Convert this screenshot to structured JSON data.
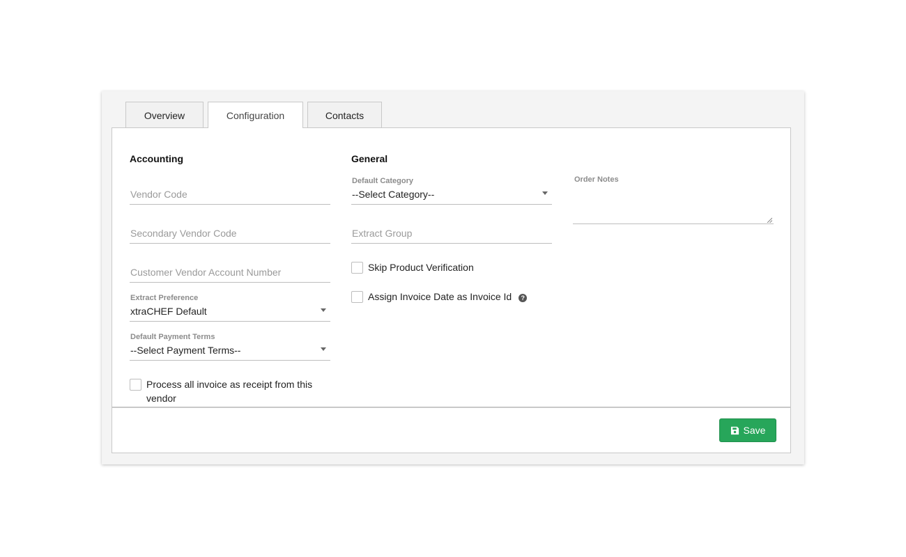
{
  "tabs": [
    {
      "label": "Overview",
      "active": false
    },
    {
      "label": "Configuration",
      "active": true
    },
    {
      "label": "Contacts",
      "active": false
    }
  ],
  "accounting": {
    "title": "Accounting",
    "vendor_code": {
      "placeholder": "Vendor Code",
      "value": ""
    },
    "secondary_vendor_code": {
      "placeholder": "Secondary Vendor Code",
      "value": ""
    },
    "customer_vendor_account_number": {
      "placeholder": "Customer Vendor Account Number",
      "value": ""
    },
    "extract_preference": {
      "label": "Extract Preference",
      "value": "xtraCHEF Default"
    },
    "default_payment_terms": {
      "label": "Default Payment Terms",
      "value": "--Select Payment Terms--"
    },
    "process_receipt": {
      "label": "Process all invoice as receipt from this vendor",
      "checked": false
    }
  },
  "general": {
    "title": "General",
    "default_category": {
      "label": "Default Category",
      "value": "--Select Category--"
    },
    "extract_group": {
      "placeholder": "Extract Group",
      "value": ""
    },
    "skip_product_verification": {
      "label": "Skip Product Verification",
      "checked": false
    },
    "assign_invoice_date": {
      "label": "Assign Invoice Date as Invoice Id",
      "checked": false
    },
    "help_icon": "question-circle-icon"
  },
  "order_notes": {
    "label": "Order Notes",
    "value": ""
  },
  "footer": {
    "save_label": "Save",
    "save_icon": "floppy-disk-icon",
    "save_color": "#27a65a"
  }
}
